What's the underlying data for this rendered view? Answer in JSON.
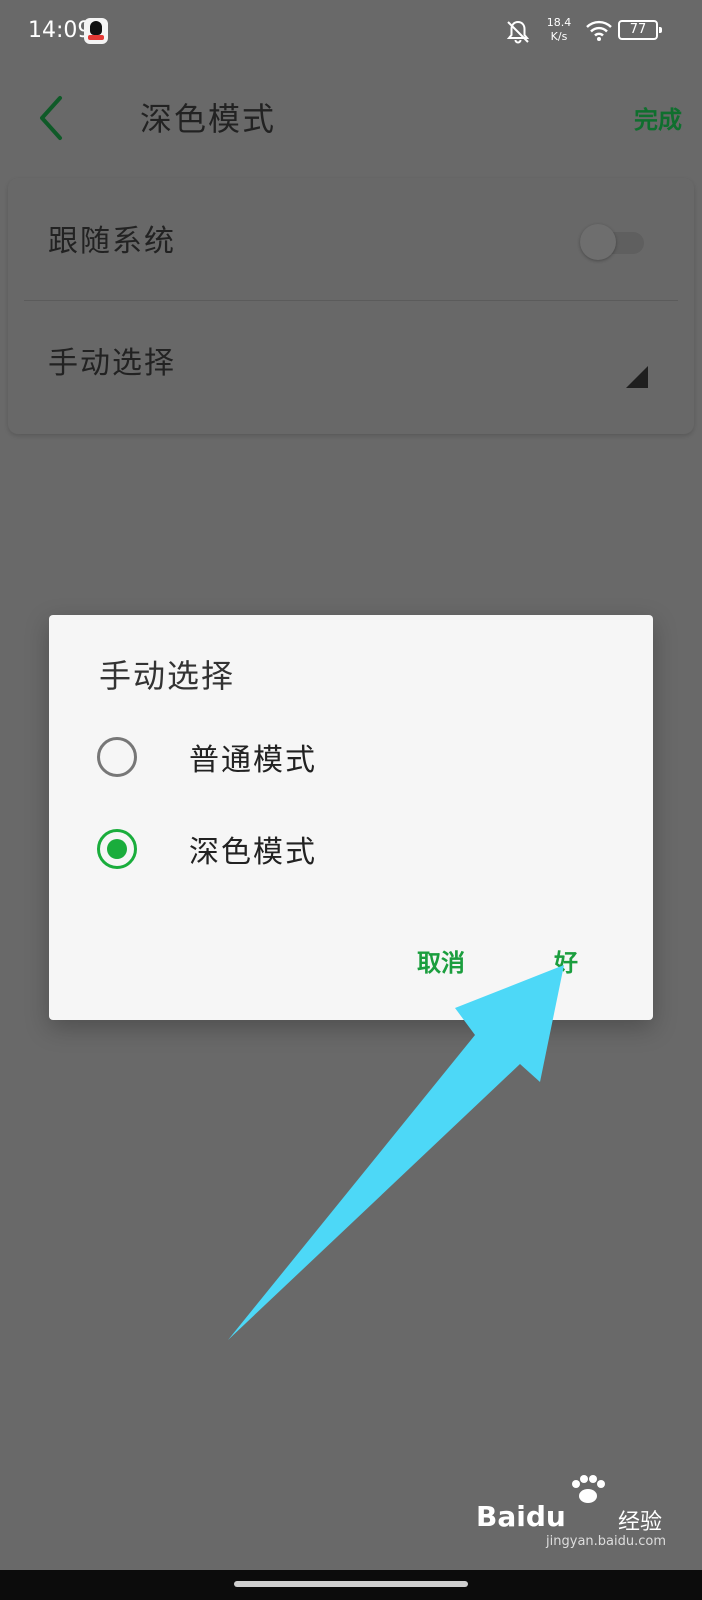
{
  "status_bar": {
    "time": "14:09",
    "net_speed_value": "18.4",
    "net_speed_unit": "K/s",
    "battery": "77",
    "icons": [
      "qq-icon",
      "bell-off-icon",
      "wifi-icon",
      "battery-icon"
    ]
  },
  "header": {
    "title": "深色模式",
    "done_label": "完成",
    "back_icon": "chevron-left-icon"
  },
  "settings": {
    "follow_system_label": "跟随系统",
    "follow_system_on": false,
    "manual_label": "手动选择"
  },
  "dialog": {
    "title": "手动选择",
    "options": [
      {
        "label": "普通模式",
        "selected": false
      },
      {
        "label": "深色模式",
        "selected": true
      }
    ],
    "cancel_label": "取消",
    "ok_label": "好"
  },
  "watermark": {
    "brand": "Bai",
    "brand_end": "du",
    "suffix": "经验",
    "url": "jingyan.baidu.com"
  },
  "colors": {
    "accent_green": "#1aad3c",
    "done_green": "#0f6f2e",
    "overlay": "#696969",
    "dialog_bg": "#f6f6f6",
    "annotation_arrow": "#4dd8f7"
  }
}
